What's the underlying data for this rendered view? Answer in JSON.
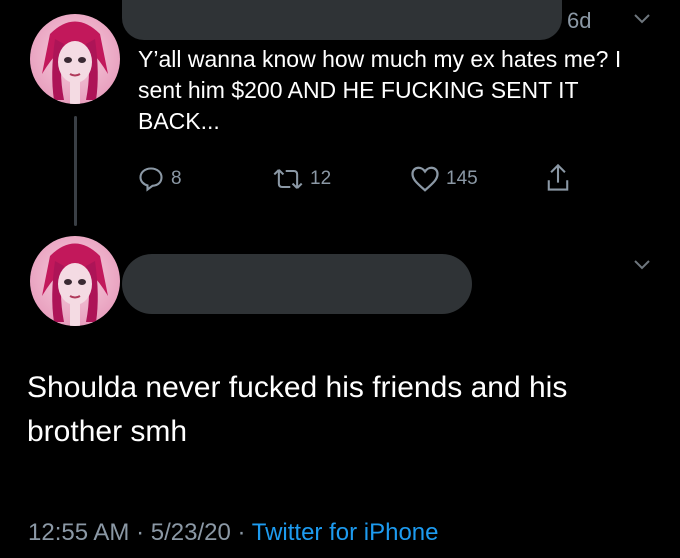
{
  "tweet1": {
    "time": "6d",
    "text": "Y’all wanna know how much my ex hates me? I sent him $200 AND HE FUCKING SENT IT BACK...",
    "actions": {
      "replies": "8",
      "retweets": "12",
      "likes": "145"
    }
  },
  "tweet2": {
    "text": "Shoulda never fucked his friends and his brother smh",
    "time": "12:55 AM",
    "date": "5/23/20",
    "separator": "·",
    "source": "Twitter for iPhone"
  },
  "colors": {
    "background": "#000000",
    "text": "#ffffff",
    "muted": "#8b98a5",
    "link": "#1d9bf0",
    "redaction": "#2f3336"
  },
  "icons": [
    "reply-icon",
    "retweet-icon",
    "like-icon",
    "share-icon",
    "chevron-down-icon"
  ]
}
